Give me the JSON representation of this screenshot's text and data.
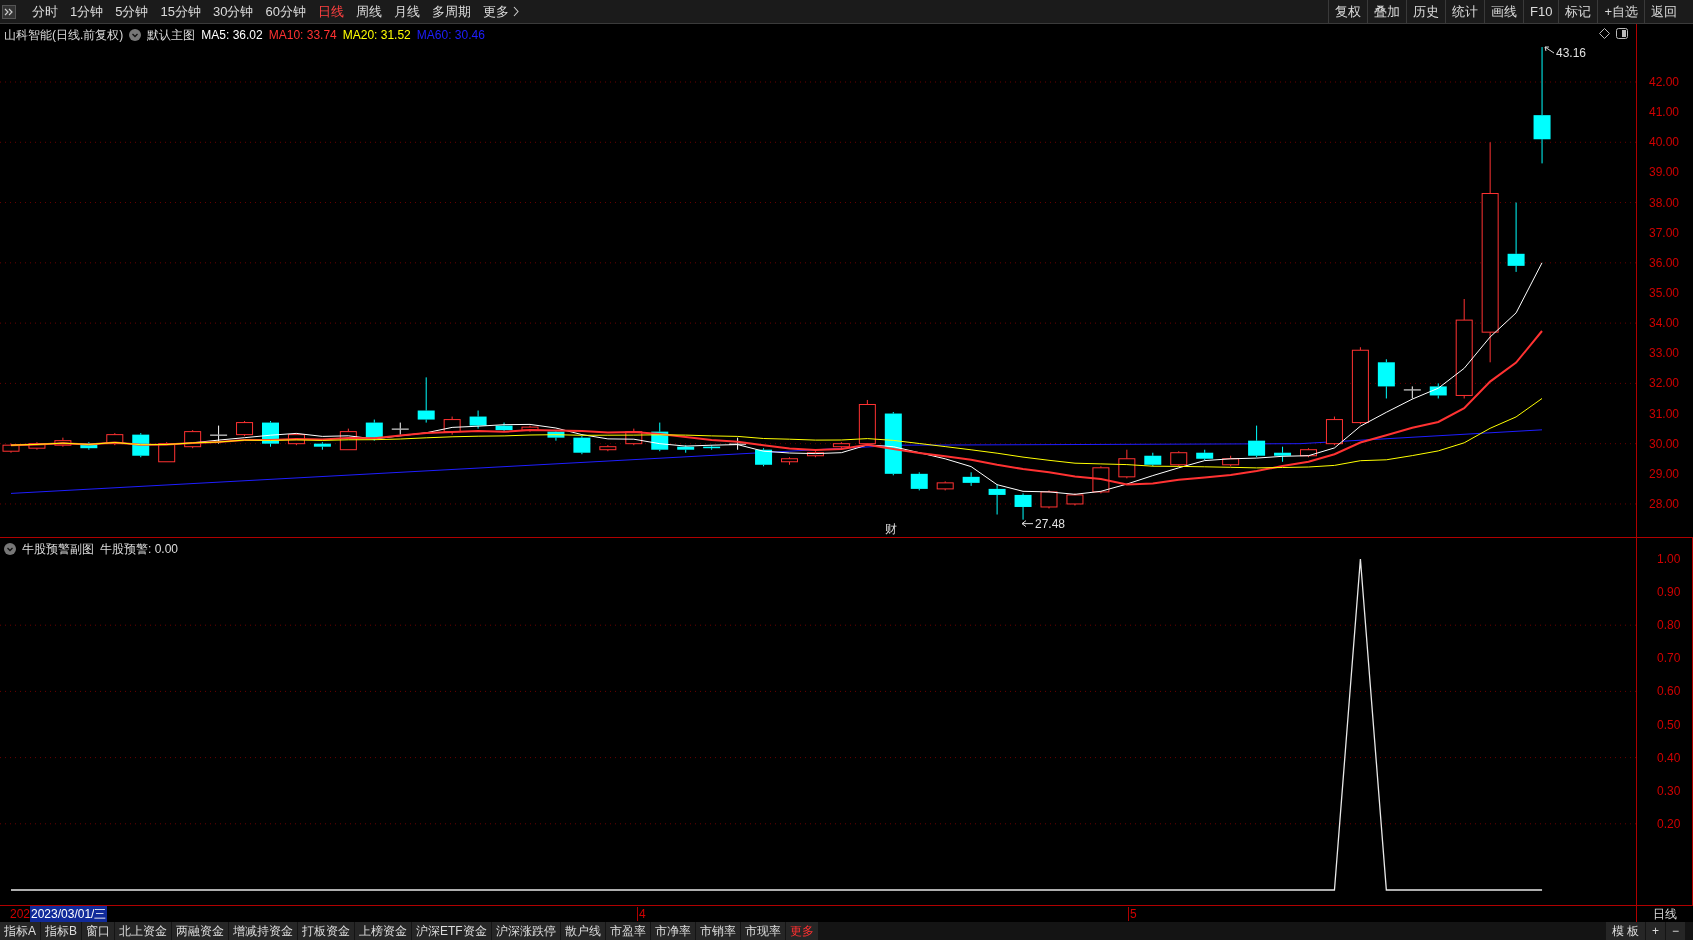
{
  "toolbar": {
    "periods": [
      {
        "label": "分时",
        "selected": false
      },
      {
        "label": "1分钟",
        "selected": false
      },
      {
        "label": "5分钟",
        "selected": false
      },
      {
        "label": "15分钟",
        "selected": false
      },
      {
        "label": "30分钟",
        "selected": false
      },
      {
        "label": "60分钟",
        "selected": false
      },
      {
        "label": "日线",
        "selected": true
      },
      {
        "label": "周线",
        "selected": false
      },
      {
        "label": "月线",
        "selected": false
      },
      {
        "label": "多周期",
        "selected": false
      }
    ],
    "more": "更多",
    "actions": [
      "复权",
      "叠加",
      "历史",
      "统计",
      "画线",
      "F10",
      "标记",
      "+自选",
      "返回"
    ]
  },
  "main_chart": {
    "title": "山科智能(日线.前复权)",
    "indicator": "默认主图",
    "moving_averages": [
      {
        "label": "MA5: 36.02",
        "color": "#ffffff"
      },
      {
        "label": "MA10: 33.74",
        "color": "#ff3232"
      },
      {
        "label": "MA20: 31.52",
        "color": "#ffff00"
      },
      {
        "label": "MA60: 30.46",
        "color": "#1e1eff"
      }
    ],
    "price_ticks": [
      "42.00",
      "41.00",
      "40.00",
      "39.00",
      "38.00",
      "37.00",
      "36.00",
      "35.00",
      "34.00",
      "33.00",
      "32.00",
      "31.00",
      "30.00",
      "29.00",
      "28.00"
    ],
    "high_label": "43.16",
    "low_label": "27.48",
    "event_marker": "财"
  },
  "sub_chart": {
    "title": "牛股预警副图",
    "reading": "牛股预警: 0.00",
    "ticks": [
      "1.00",
      "0.90",
      "0.80",
      "0.70",
      "0.60",
      "0.50",
      "0.40",
      "0.30",
      "0.20"
    ]
  },
  "date_axis": {
    "cut_label": "202",
    "cursor_date": "2023/03/01/三",
    "months": [
      "4",
      "5"
    ],
    "period": "日线"
  },
  "bottom_tabs": [
    {
      "label": "指标A",
      "accent": false
    },
    {
      "label": "指标B",
      "accent": false
    },
    {
      "label": "窗口",
      "accent": false
    },
    {
      "label": "北上资金",
      "accent": false
    },
    {
      "label": "两融资金",
      "accent": false
    },
    {
      "label": "增减持资金",
      "accent": false
    },
    {
      "label": "打板资金",
      "accent": false
    },
    {
      "label": "上榜资金",
      "accent": false
    },
    {
      "label": "沪深ETF资金",
      "accent": false
    },
    {
      "label": "沪深涨跌停",
      "accent": false
    },
    {
      "label": "散户线",
      "accent": false
    },
    {
      "label": "市盈率",
      "accent": false
    },
    {
      "label": "市净率",
      "accent": false
    },
    {
      "label": "市销率",
      "accent": false
    },
    {
      "label": "市现率",
      "accent": false
    },
    {
      "label": "更多",
      "accent": true
    }
  ],
  "bottom_right": [
    "模 板",
    "+",
    "−"
  ]
}
